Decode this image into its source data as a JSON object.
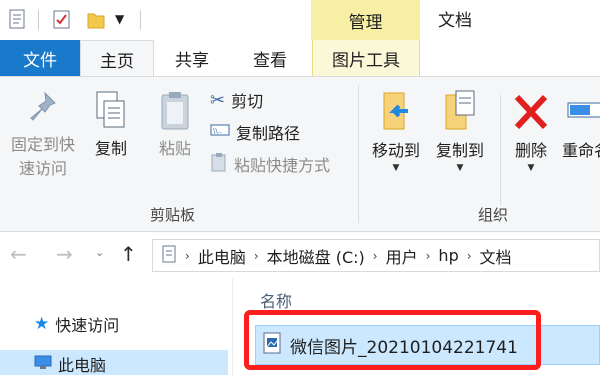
{
  "window": {
    "title": "文档",
    "context_header": "管理"
  },
  "tabs": {
    "file": "文件",
    "home": "主页",
    "share": "共享",
    "view": "查看",
    "picture_tools": "图片工具"
  },
  "ribbon": {
    "pin_line1": "固定到快",
    "pin_line2": "速访问",
    "copy": "复制",
    "paste": "粘贴",
    "cut": "剪切",
    "copy_path": "复制路径",
    "paste_shortcut": "粘贴快捷方式",
    "clipboard_group": "剪贴板",
    "move_to": "移动到",
    "copy_to": "复制到",
    "delete": "删除",
    "rename": "重命名",
    "organize_group": "组织"
  },
  "breadcrumb": [
    "此电脑",
    "本地磁盘 (C:)",
    "用户",
    "hp",
    "文档"
  ],
  "nav_pane": {
    "quick_access": "快速访问",
    "this_pc": "此电脑"
  },
  "content": {
    "column_name": "名称",
    "file_name": "微信图片_20210104221741"
  },
  "colors": {
    "accent": "#1979ca",
    "context_tab": "#f7f0a4",
    "selection": "#cce8ff",
    "highlight": "#ff1e1e"
  }
}
